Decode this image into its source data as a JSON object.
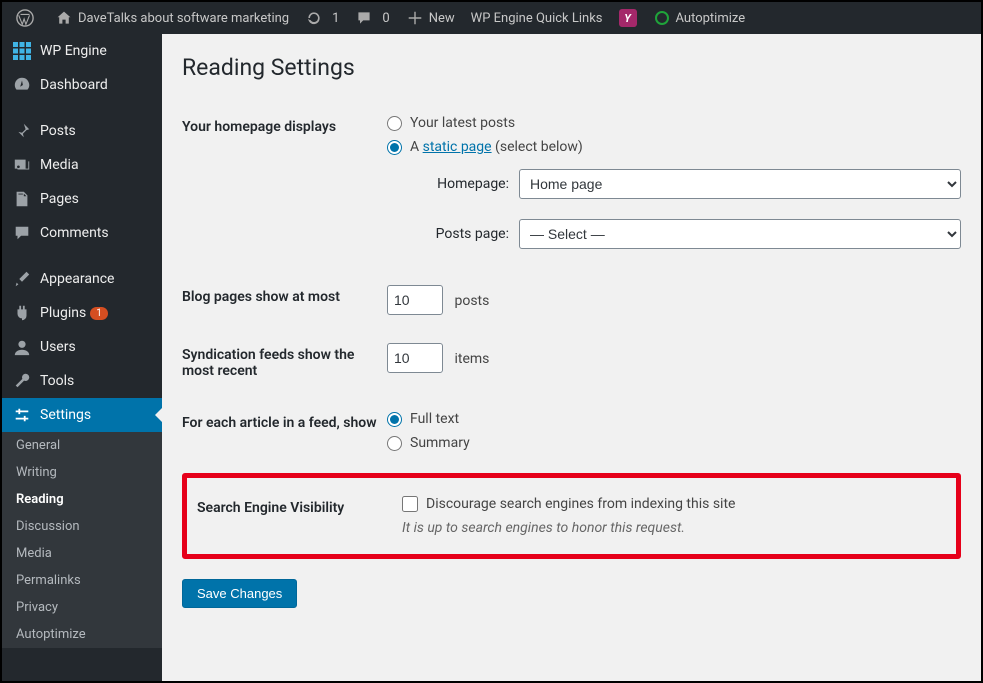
{
  "adminbar": {
    "site_name": "DaveTalks about software marketing",
    "updates_count": "1",
    "comments_count": "0",
    "new_label": "New",
    "wpengine_label": "WP Engine Quick Links",
    "yoast_glyph": "Y",
    "autoptimize_label": "Autoptimize"
  },
  "sidebar": {
    "items": [
      {
        "label": "WP Engine"
      },
      {
        "label": "Dashboard"
      },
      {
        "label": "Posts"
      },
      {
        "label": "Media"
      },
      {
        "label": "Pages"
      },
      {
        "label": "Comments"
      },
      {
        "label": "Appearance"
      },
      {
        "label": "Plugins",
        "badge": "1"
      },
      {
        "label": "Users"
      },
      {
        "label": "Tools"
      },
      {
        "label": "Settings"
      }
    ],
    "submenu": [
      "General",
      "Writing",
      "Reading",
      "Discussion",
      "Media",
      "Permalinks",
      "Privacy",
      "Autoptimize"
    ]
  },
  "page": {
    "title": "Reading Settings",
    "fields": {
      "homepage_displays_label": "Your homepage displays",
      "latest_posts_label": "Your latest posts",
      "static_page_prefix": "A ",
      "static_page_link": "static page",
      "static_page_suffix": " (select below)",
      "homepage_label": "Homepage:",
      "homepage_value": "Home page",
      "posts_page_label": "Posts page:",
      "posts_page_value": "— Select —",
      "blog_pages_label": "Blog pages show at most",
      "blog_pages_value": "10",
      "blog_pages_unit": "posts",
      "syndication_label": "Syndication feeds show the most recent",
      "syndication_value": "10",
      "syndication_unit": "items",
      "feed_article_label": "For each article in a feed, show",
      "full_text_label": "Full text",
      "summary_label": "Summary",
      "sev_label": "Search Engine Visibility",
      "sev_checkbox_label": "Discourage search engines from indexing this site",
      "sev_description": "It is up to search engines to honor this request.",
      "save_button": "Save Changes"
    }
  }
}
